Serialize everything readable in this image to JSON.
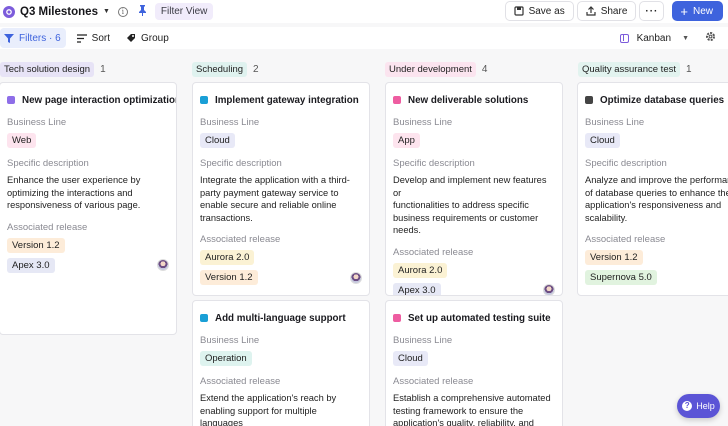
{
  "header": {
    "title": "Q3 Milestones",
    "filter_view": "Filter View",
    "save_as": "Save as",
    "share": "Share",
    "more": "···",
    "new": "New"
  },
  "toolbar": {
    "filters": "Filters · 6",
    "sort": "Sort",
    "group": "Group",
    "view": "Kanban"
  },
  "labels": {
    "business_line": "Business Line",
    "specific_description": "Specific description",
    "associated_release": "Associated release"
  },
  "columns": [
    {
      "name": "Tech solution design",
      "count": "1",
      "color": "#e7e3f6",
      "cards": [
        {
          "title": "New page interaction optimization",
          "icon_color": "#8e6ee8",
          "business_line": "Web",
          "description": "Enhance the user experience by\noptimizing the interactions and\nresponsiveness of various page.",
          "releases": [
            "Version 1.2",
            "Apex 3.0"
          ]
        }
      ]
    },
    {
      "name": "Scheduling",
      "count": "2",
      "color": "#dff2ef",
      "cards": [
        {
          "title": "Implement gateway integration",
          "icon_color": "#1a9fd6",
          "business_line": "Cloud",
          "description": "Integrate the application with a third-\nparty payment gateway service to\nenable secure and reliable online\ntransactions.",
          "releases": [
            "Aurora 2.0",
            "Version 1.2"
          ]
        },
        {
          "title": "Add multi-language support",
          "icon_color": "#1a9fd6",
          "business_line": "Operation",
          "description": "Extend the application's reach by\nenabling support for multiple languages\nand locales.",
          "releases": []
        }
      ]
    },
    {
      "name": "Under development",
      "count": "4",
      "color": "#fbe4ef",
      "cards": [
        {
          "title": "New deliverable solutions",
          "icon_color": "#ee5da1",
          "business_line": "App",
          "description": "Develop and implement new features or\nfunctionalities to address specific\nbusiness requirements or customer\nneeds.",
          "releases": [
            "Aurora 2.0",
            "Apex 3.0"
          ]
        },
        {
          "title": "Set up automated testing suite",
          "icon_color": "#ee5da1",
          "business_line": "Cloud",
          "description": "Establish a comprehensive automated\ntesting framework to ensure the\napplication's quality, reliability, and",
          "releases": []
        }
      ]
    },
    {
      "name": "Quality assurance test",
      "count": "1",
      "color": "#e2f3ef",
      "cards": [
        {
          "title": "Optimize database queries",
          "icon_color": "#444444",
          "business_line": "Cloud",
          "description": "Analyze and improve the performance\nof database queries to enhance the\napplication's responsiveness and\nscalability.",
          "releases": [
            "Version 1.2",
            "Supernova 5.0"
          ]
        }
      ]
    }
  ],
  "release_colors": {
    "Version 1.2": "#fdecd9",
    "Apex 3.0": "#e6e8f5",
    "Aurora 2.0": "#fbf2d4",
    "Supernova 5.0": "#e1f3df"
  },
  "business_line_colors": {
    "Web": "#fde4ee",
    "Cloud": "#e8e9f7",
    "App": "#fde4ee",
    "Operation": "#def3ef"
  },
  "help": "Help"
}
